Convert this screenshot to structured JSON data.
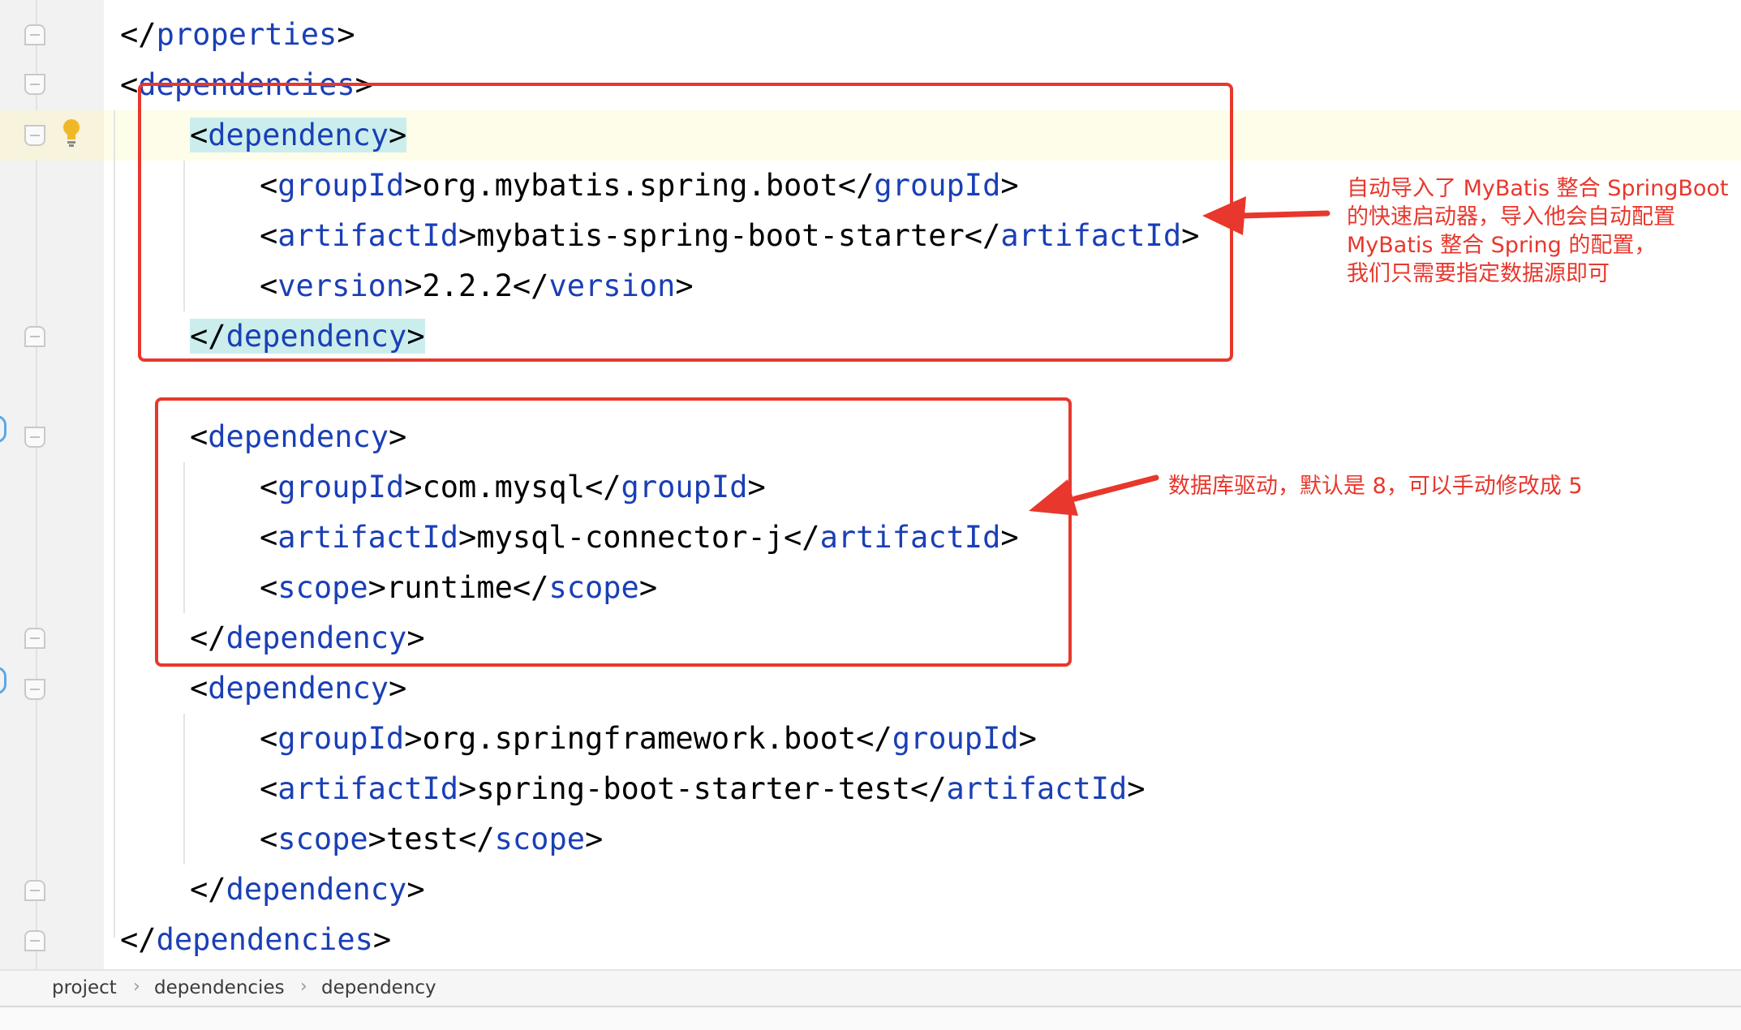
{
  "code_lines": [
    {
      "id": "properties-close",
      "parts": [
        [
          "punct",
          "</"
        ],
        [
          "tag",
          "properties"
        ],
        [
          "punct",
          ">"
        ]
      ]
    },
    {
      "id": "dependencies-open",
      "parts": [
        [
          "punct",
          "<"
        ],
        [
          "tag",
          "dependencies"
        ],
        [
          "punct",
          ">"
        ]
      ]
    },
    {
      "id": "dep1-open",
      "parts": [
        [
          "punct",
          "<"
        ],
        [
          "tag",
          "dependency"
        ],
        [
          "punct",
          ">"
        ]
      ]
    },
    {
      "id": "dep1-groupid",
      "parts": [
        [
          "punct",
          "<"
        ],
        [
          "tag",
          "groupId"
        ],
        [
          "punct",
          ">"
        ],
        [
          "txt",
          "org.mybatis.spring.boot"
        ],
        [
          "punct",
          "</"
        ],
        [
          "tag",
          "groupId"
        ],
        [
          "punct",
          ">"
        ]
      ]
    },
    {
      "id": "dep1-artifactid",
      "parts": [
        [
          "punct",
          "<"
        ],
        [
          "tag",
          "artifactId"
        ],
        [
          "punct",
          ">"
        ],
        [
          "txt",
          "mybatis-spring-boot-starter"
        ],
        [
          "punct",
          "</"
        ],
        [
          "tag",
          "artifactId"
        ],
        [
          "punct",
          ">"
        ]
      ]
    },
    {
      "id": "dep1-version",
      "parts": [
        [
          "punct",
          "<"
        ],
        [
          "tag",
          "version"
        ],
        [
          "punct",
          ">"
        ],
        [
          "txt",
          "2.2.2"
        ],
        [
          "punct",
          "</"
        ],
        [
          "tag",
          "version"
        ],
        [
          "punct",
          ">"
        ]
      ]
    },
    {
      "id": "dep1-close",
      "parts": [
        [
          "punct",
          "</"
        ],
        [
          "tag",
          "dependency"
        ],
        [
          "punct",
          ">"
        ]
      ]
    },
    {
      "id": "blank",
      "parts": []
    },
    {
      "id": "dep2-open",
      "parts": [
        [
          "punct",
          "<"
        ],
        [
          "tag",
          "dependency"
        ],
        [
          "punct",
          ">"
        ]
      ]
    },
    {
      "id": "dep2-groupid",
      "parts": [
        [
          "punct",
          "<"
        ],
        [
          "tag",
          "groupId"
        ],
        [
          "punct",
          ">"
        ],
        [
          "txt",
          "com.mysql"
        ],
        [
          "punct",
          "</"
        ],
        [
          "tag",
          "groupId"
        ],
        [
          "punct",
          ">"
        ]
      ]
    },
    {
      "id": "dep2-artifactid",
      "parts": [
        [
          "punct",
          "<"
        ],
        [
          "tag",
          "artifactId"
        ],
        [
          "punct",
          ">"
        ],
        [
          "txt",
          "mysql-connector-j"
        ],
        [
          "punct",
          "</"
        ],
        [
          "tag",
          "artifactId"
        ],
        [
          "punct",
          ">"
        ]
      ]
    },
    {
      "id": "dep2-scope",
      "parts": [
        [
          "punct",
          "<"
        ],
        [
          "tag",
          "scope"
        ],
        [
          "punct",
          ">"
        ],
        [
          "txt",
          "runtime"
        ],
        [
          "punct",
          "</"
        ],
        [
          "tag",
          "scope"
        ],
        [
          "punct",
          ">"
        ]
      ]
    },
    {
      "id": "dep2-close",
      "parts": [
        [
          "punct",
          "</"
        ],
        [
          "tag",
          "dependency"
        ],
        [
          "punct",
          ">"
        ]
      ]
    },
    {
      "id": "dep3-open",
      "parts": [
        [
          "punct",
          "<"
        ],
        [
          "tag",
          "dependency"
        ],
        [
          "punct",
          ">"
        ]
      ]
    },
    {
      "id": "dep3-groupid",
      "parts": [
        [
          "punct",
          "<"
        ],
        [
          "tag",
          "groupId"
        ],
        [
          "punct",
          ">"
        ],
        [
          "txt",
          "org.springframework.boot"
        ],
        [
          "punct",
          "</"
        ],
        [
          "tag",
          "groupId"
        ],
        [
          "punct",
          ">"
        ]
      ]
    },
    {
      "id": "dep3-artifactid",
      "parts": [
        [
          "punct",
          "<"
        ],
        [
          "tag",
          "artifactId"
        ],
        [
          "punct",
          ">"
        ],
        [
          "txt",
          "spring-boot-starter-test"
        ],
        [
          "punct",
          "</"
        ],
        [
          "tag",
          "artifactId"
        ],
        [
          "punct",
          ">"
        ]
      ]
    },
    {
      "id": "dep3-scope",
      "parts": [
        [
          "punct",
          "<"
        ],
        [
          "tag",
          "scope"
        ],
        [
          "punct",
          ">"
        ],
        [
          "txt",
          "test"
        ],
        [
          "punct",
          "</"
        ],
        [
          "tag",
          "scope"
        ],
        [
          "punct",
          ">"
        ]
      ]
    },
    {
      "id": "dep3-close",
      "parts": [
        [
          "punct",
          "</"
        ],
        [
          "tag",
          "dependency"
        ],
        [
          "punct",
          ">"
        ]
      ]
    },
    {
      "id": "dependencies-close",
      "parts": [
        [
          "punct",
          "</"
        ],
        [
          "tag",
          "dependencies"
        ],
        [
          "punct",
          ">"
        ]
      ]
    }
  ],
  "annotations": {
    "note_mybatis": [
      "自动导入了 MyBatis 整合 SpringBoot",
      "的快速启动器，导入他会自动配置",
      "MyBatis 整合 Spring 的配置，",
      "我们只需要指定数据源即可"
    ],
    "note_mysql": "数据库驱动，默认是 8，可以手动修改成 5",
    "color": "#e8372c"
  },
  "breadcrumb": {
    "items": [
      "project",
      "dependencies",
      "dependency"
    ],
    "separator": "›"
  },
  "icons": {
    "gutter_hint": "lightbulb-icon",
    "fold": "fold-marker-icon"
  },
  "colors": {
    "tag": "#1a3fb6",
    "text": "#000000",
    "brace_match": "#cbeeed",
    "current_line": "#fefdea"
  }
}
